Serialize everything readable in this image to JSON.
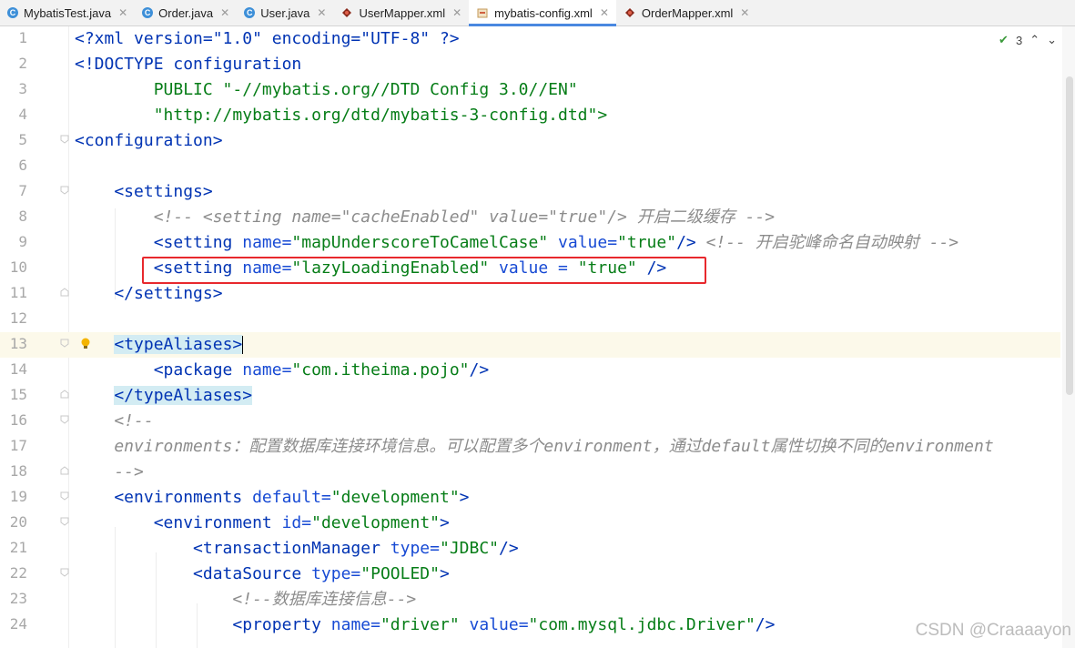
{
  "tabs": [
    {
      "label": "MybatisTest.java",
      "icon": "java-class-icon"
    },
    {
      "label": "Order.java",
      "icon": "java-class-icon"
    },
    {
      "label": "User.java",
      "icon": "java-class-icon"
    },
    {
      "label": "UserMapper.xml",
      "icon": "mapper-xml-icon"
    },
    {
      "label": "mybatis-config.xml",
      "icon": "config-xml-icon"
    },
    {
      "label": "OrderMapper.xml",
      "icon": "mapper-xml-icon"
    }
  ],
  "active_tab": "mybatis-config.xml",
  "inspection": {
    "count": "3"
  },
  "line_numbers": [
    "1",
    "2",
    "3",
    "4",
    "5",
    "6",
    "7",
    "8",
    "9",
    "10",
    "11",
    "12",
    "13",
    "14",
    "15",
    "16",
    "17",
    "18",
    "19",
    "20",
    "21",
    "22",
    "23",
    "24"
  ],
  "code": {
    "l1": {
      "a": "<?xml version=\"1.0\" encoding=\"UTF-8\" ?>"
    },
    "l2": {
      "a": "<!DOCTYPE configuration"
    },
    "l3": {
      "a": "        PUBLIC \"-//mybatis.org//DTD Config 3.0//EN\""
    },
    "l4": {
      "a": "        \"http://mybatis.org/dtd/mybatis-3-config.dtd\">"
    },
    "l5": {
      "a": "<configuration>"
    },
    "l7": {
      "a": "    <settings>"
    },
    "l8": {
      "a": "        <!-- <setting name=\"cacheEnabled\" value=\"true\"/> 开启二级缓存 -->"
    },
    "l9": {
      "tag": "        <setting",
      "attr": " name=",
      "val": "\"mapUnderscoreToCamelCase\"",
      "attr2": " value=",
      "val2": "\"true\"",
      "end": "/>",
      "cmt": " <!-- 开启驼峰命名自动映射 -->"
    },
    "l10": {
      "tag": "        <setting",
      "attr": " name=",
      "val": "\"lazyLoadingEnabled\"",
      "attr2": " value = ",
      "val2": "\"true\"",
      "end": " />"
    },
    "l11": {
      "a": "    </settings>"
    },
    "l13": {
      "a": "<typeAliases>"
    },
    "l14": {
      "tag": "        <package",
      "attr": " name=",
      "val": "\"com.itheima.pojo\"",
      "end": "/>"
    },
    "l15": {
      "a": "</typeAliases>"
    },
    "l16": {
      "a": "    <!--"
    },
    "l17": {
      "a": "    environments：配置数据库连接环境信息。可以配置多个environment，通过default属性切换不同的environment"
    },
    "l18": {
      "a": "    -->"
    },
    "l19": {
      "tag": "    <environments",
      "attr": " default=",
      "val": "\"development\"",
      "end": ">"
    },
    "l20": {
      "tag": "        <environment",
      "attr": " id=",
      "val": "\"development\"",
      "end": ">"
    },
    "l21": {
      "tag": "            <transactionManager",
      "attr": " type=",
      "val": "\"JDBC\"",
      "end": "/>"
    },
    "l22": {
      "tag": "            <dataSource",
      "attr": " type=",
      "val": "\"POOLED\"",
      "end": ">"
    },
    "l23": {
      "a": "                <!--数据库连接信息-->"
    },
    "l24": {
      "tag": "                <property",
      "attr": " name=",
      "val": "\"driver\"",
      "attr2": " value=",
      "val2": "\"com.mysql.jdbc.Driver\"",
      "end": "/>"
    }
  },
  "watermark": "CSDN @Craaaayon",
  "colors": {
    "tag": "#0033b3",
    "attr": "#174ad4",
    "string": "#067d17",
    "comment": "#8c8c8c",
    "highlight_box": "#e8282d",
    "active_tab_underline": "#4a88e0"
  }
}
